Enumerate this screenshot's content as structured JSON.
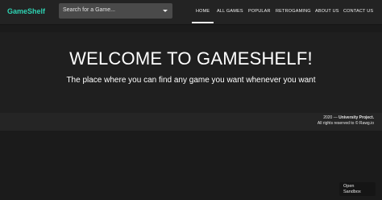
{
  "navbar": {
    "brand": "GameShelf",
    "search_placeholder": "Search for a Game...",
    "items": [
      {
        "label": "HOME",
        "active": true
      },
      {
        "label": "ALL GAMES"
      },
      {
        "label": "POPULAR"
      },
      {
        "label": "RETROGAMING"
      },
      {
        "label": "ABOUT US"
      },
      {
        "label": "CONTACT US"
      }
    ]
  },
  "hero": {
    "title": "WELCOME TO GAMESHELF!",
    "subtitle": "The place where you can find any game you want whenever you want"
  },
  "footer": {
    "year": "2020 —",
    "project": "University Project.",
    "rights": "All rights reserved to © Rawg.io"
  },
  "sandbox_button": {
    "label": "Open Sandbox"
  },
  "colors": {
    "brand": "#2ed3b3",
    "navbar_bg": "#232323",
    "page_bg": "#1b1b1b"
  }
}
